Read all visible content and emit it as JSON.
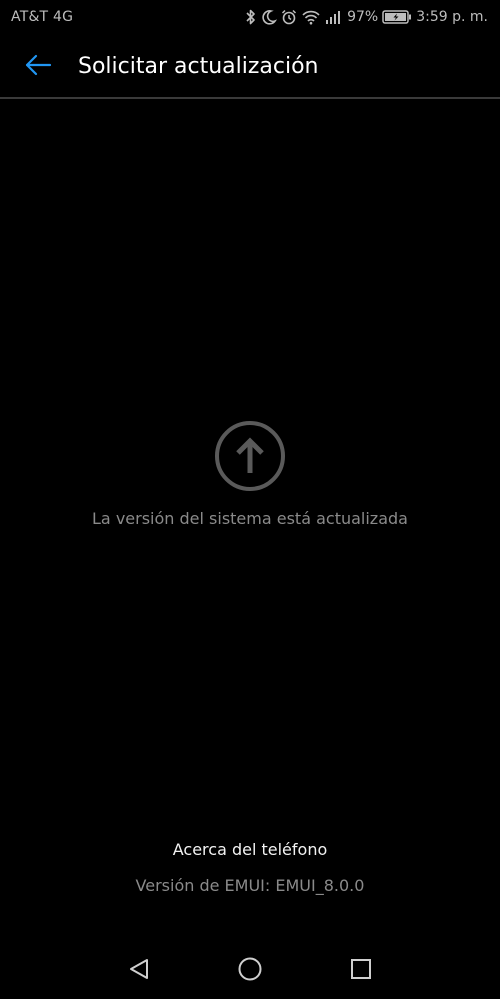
{
  "status_bar": {
    "carrier": "AT&T 4G",
    "battery": "97%",
    "time": "3:59 p. m.",
    "icons": [
      "bluetooth-icon",
      "moon-icon",
      "alarm-icon",
      "wifi-icon",
      "signal-icon",
      "battery-icon"
    ]
  },
  "app_bar": {
    "back_icon": "arrow-left-icon",
    "title": "Solicitar actualización"
  },
  "main": {
    "icon": "arrow-up-circle-icon",
    "status_text": "La versión del sistema está actualizada"
  },
  "footer": {
    "about_label": "Acerca del teléfono",
    "version_text": "Versión de EMUI: EMUI_8.0.0"
  },
  "nav_bar": {
    "icons": [
      "back-triangle-icon",
      "home-circle-icon",
      "recents-square-icon"
    ]
  },
  "colors": {
    "accent": "#2196f3",
    "background": "#000000",
    "secondary_text": "#8a8a8a"
  }
}
